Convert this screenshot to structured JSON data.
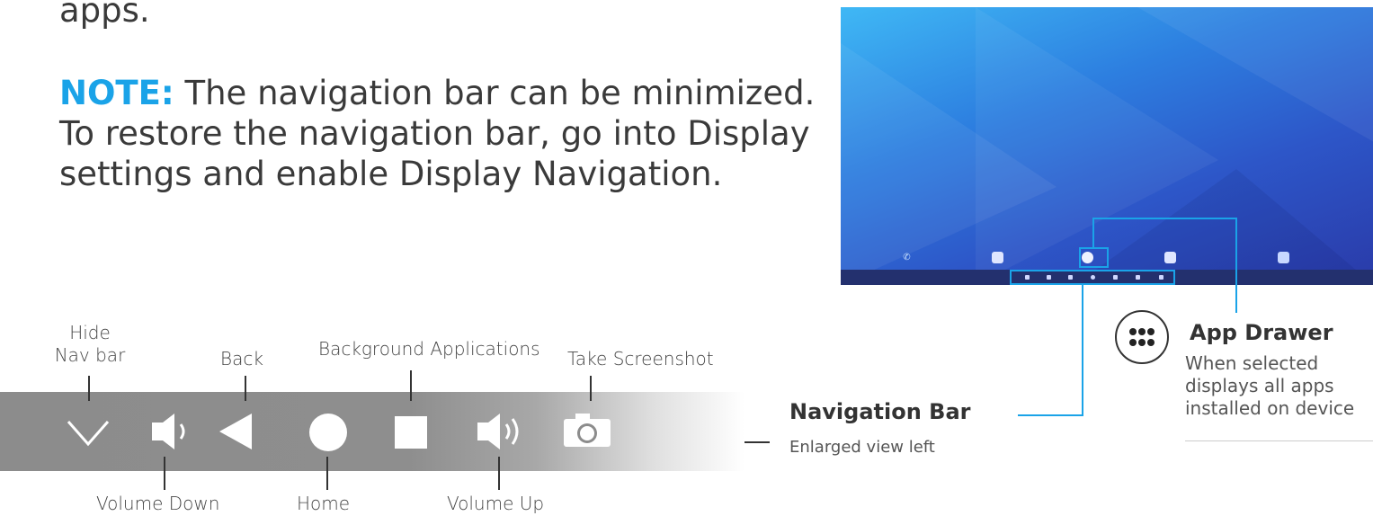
{
  "intro_text": "apps.",
  "note": {
    "keyword": "NOTE:",
    "text": " The navigation bar can be minimized. To restore the navigation bar, go into Display settings and enable Display Navigation."
  },
  "navbar_labels": {
    "hide_nav": "Hide",
    "hide_nav_line2": "Nav bar",
    "back": "Back",
    "background_apps": "Background Applications",
    "screenshot": "Take Screenshot",
    "volume_down": "Volume Down",
    "home": "Home",
    "volume_up": "Volume Up"
  },
  "navigation_bar": {
    "title": "Navigation Bar",
    "subtitle": "Enlarged view left"
  },
  "app_drawer": {
    "title": "App Drawer",
    "description_line1": "When selected",
    "description_line2": "displays all apps",
    "description_line3": "installed on device"
  },
  "colors": {
    "accent": "#1aa3e8",
    "navbar_gray": "#8c8c8c",
    "screen_blue": "#2d56c8"
  },
  "icons": {
    "hide": "chevron-down-icon",
    "volume_down": "volume-down-icon",
    "back": "back-triangle-icon",
    "home": "home-circle-icon",
    "recents": "recents-square-icon",
    "volume_up": "volume-up-icon",
    "screenshot": "camera-icon",
    "app_drawer": "app-drawer-dots-icon"
  }
}
